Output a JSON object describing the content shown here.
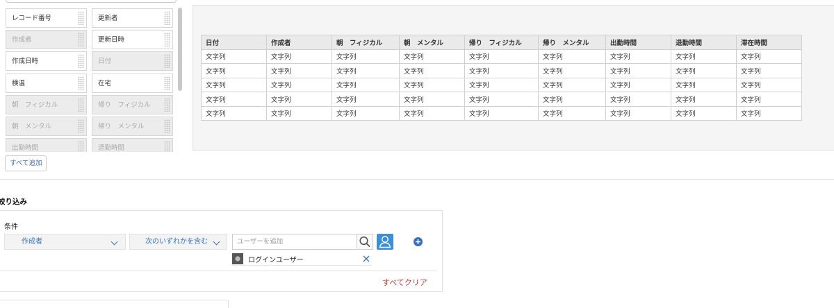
{
  "palette": {
    "chips": [
      {
        "label": "レコード番号",
        "used": false
      },
      {
        "label": "更新者",
        "used": false
      },
      {
        "label": "作成者",
        "used": true
      },
      {
        "label": "更新日時",
        "used": false
      },
      {
        "label": "作成日時",
        "used": false
      },
      {
        "label": "日付",
        "used": true
      },
      {
        "label": "検温",
        "used": false
      },
      {
        "label": "在宅",
        "used": false
      },
      {
        "label": "朝　フィジカル",
        "used": true
      },
      {
        "label": "帰り　フィジカル",
        "used": true
      },
      {
        "label": "朝　メンタル",
        "used": true
      },
      {
        "label": "帰り　メンタル",
        "used": true
      },
      {
        "label": "出勤時間",
        "used": true
      },
      {
        "label": "退勤時間",
        "used": true
      }
    ],
    "add_all_label": "すべて追加"
  },
  "preview": {
    "columns": [
      "日付",
      "作成者",
      "朝　フィジカル",
      "朝　メンタル",
      "帰り　フィジカル",
      "帰り　メンタル",
      "出勤時間",
      "退勤時間",
      "滞在時間"
    ],
    "rows": [
      [
        "文字列",
        "文字列",
        "文字列",
        "文字列",
        "文字列",
        "文字列",
        "文字列",
        "文字列",
        "文字列"
      ],
      [
        "文字列",
        "文字列",
        "文字列",
        "文字列",
        "文字列",
        "文字列",
        "文字列",
        "文字列",
        "文字列"
      ],
      [
        "文字列",
        "文字列",
        "文字列",
        "文字列",
        "文字列",
        "文字列",
        "文字列",
        "文字列",
        "文字列"
      ],
      [
        "文字列",
        "文字列",
        "文字列",
        "文字列",
        "文字列",
        "文字列",
        "文字列",
        "文字列",
        "文字列"
      ],
      [
        "文字列",
        "文字列",
        "文字列",
        "文字列",
        "文字列",
        "文字列",
        "文字列",
        "文字列",
        "文字列"
      ]
    ]
  },
  "filter": {
    "title": "絞り込み",
    "condition_label": "条件",
    "field_select": "作成者",
    "operator_select": "次のいずれかを含む",
    "user_placeholder": "ユーザーを追加",
    "selected_user": "ログインユーザー",
    "clear_all_label": "すべてクリア"
  },
  "colors": {
    "accent": "#3b73b9",
    "user_button": "#3a8fd8",
    "clear": "#c0392b"
  }
}
